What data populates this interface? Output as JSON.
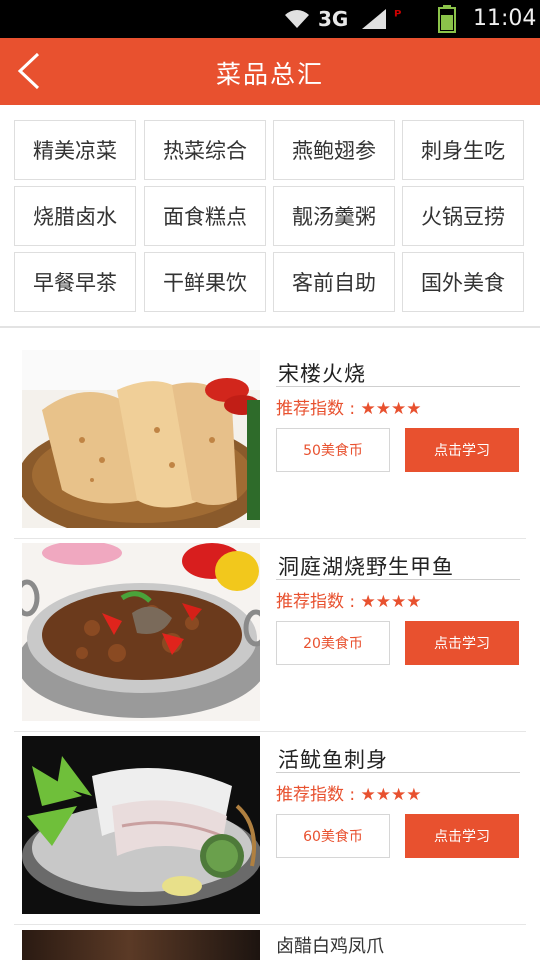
{
  "status_bar": {
    "network": "3G",
    "time": "11:04"
  },
  "header": {
    "title": "菜品总汇"
  },
  "categories": [
    "精美凉菜",
    "热菜综合",
    "燕鲍翅参",
    "刺身生吃",
    "烧腊卤水",
    "面食糕点",
    "靓汤羹粥",
    "火锅豆捞",
    "早餐早茶",
    "干鲜果饮",
    "客前自助",
    "国外美食"
  ],
  "dishes": [
    {
      "name": "宋楼火烧",
      "rating_label": "推荐指数 : ★★★★",
      "coins": "50美食币",
      "action": "点击学习"
    },
    {
      "name": "洞庭湖烧野生甲鱼",
      "rating_label": "推荐指数 : ★★★★",
      "coins": "20美食币",
      "action": "点击学习"
    },
    {
      "name": "活鱿鱼刺身",
      "rating_label": "推荐指数 : ★★★★",
      "coins": "60美食币",
      "action": "点击学习"
    }
  ],
  "partial_dish": {
    "name": "卤醋白鸡凤爪"
  },
  "colors": {
    "accent": "#e8512f",
    "status_bar": "#000000"
  }
}
